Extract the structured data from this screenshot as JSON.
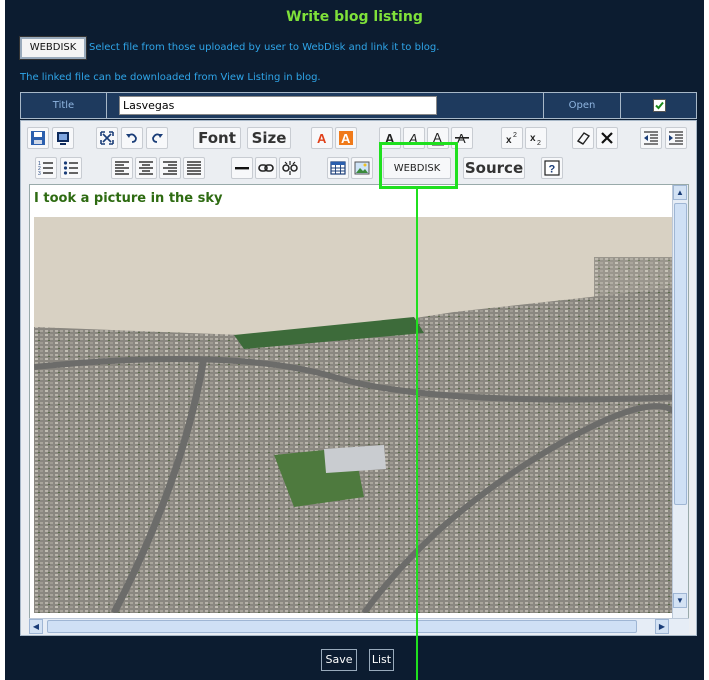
{
  "page": {
    "title": "Write blog listing",
    "webdisk_button": "WEBDISK",
    "desc_select": "Select file from those uploaded by user to WebDisk and link it to blog.",
    "desc_linked": "The linked file can be downloaded from View Listing in blog."
  },
  "title_row": {
    "label": "Title",
    "value": "Lasvegas",
    "open_label": "Open",
    "open_checked": true
  },
  "toolbar": {
    "font_label": "Font",
    "size_label": "Size",
    "webdisk_label": "WEBDISK",
    "source_label": "Source"
  },
  "editor": {
    "text": "I took a picture in the sky"
  },
  "buttons": {
    "save": "Save",
    "list": "List"
  },
  "colors": {
    "background": "#0c1c30",
    "title": "#7fe13a",
    "description": "#2fa5e8",
    "highlight": "#1fe01f",
    "editor_text": "#2e6b12"
  }
}
